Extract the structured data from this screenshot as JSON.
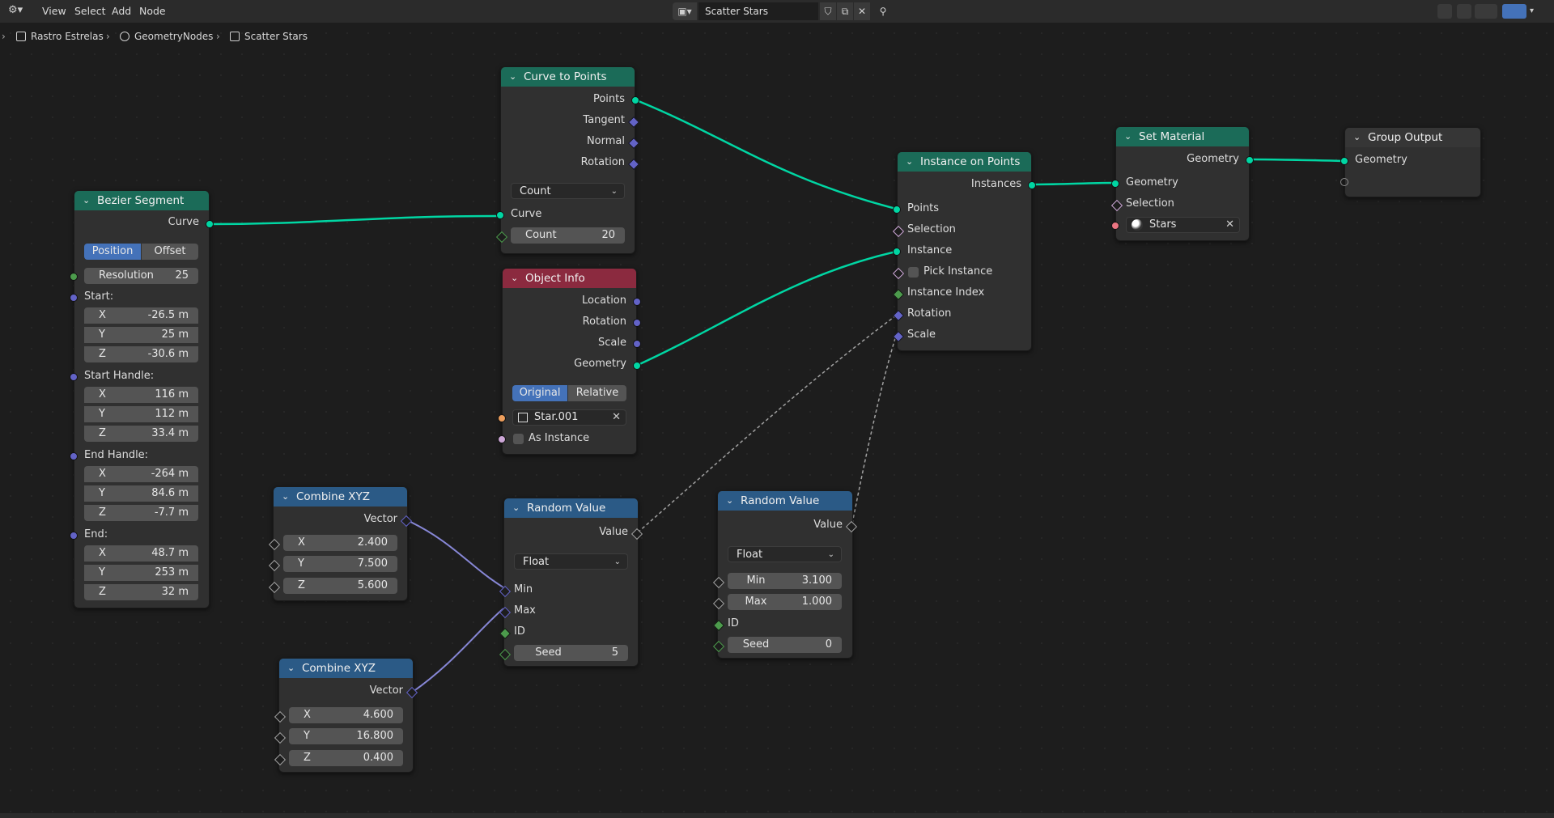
{
  "topbar": {
    "menus": [
      "View",
      "Select",
      "Add",
      "Node"
    ],
    "node_tree_name": "Scatter Stars"
  },
  "breadcrumb": {
    "object": "Rastro Estrelas",
    "modifier": "GeometryNodes",
    "tree": "Scatter Stars"
  },
  "nodes": {
    "bezier": {
      "title": "Bezier Segment",
      "out_curve": "Curve",
      "mode_position": "Position",
      "mode_offset": "Offset",
      "resolution_label": "Resolution",
      "resolution_value": "25",
      "start_label": "Start:",
      "start_x": "-26.5 m",
      "start_y": "25 m",
      "start_z": "-30.6 m",
      "start_handle_label": "Start Handle:",
      "sh_x": "116 m",
      "sh_y": "112 m",
      "sh_z": "33.4 m",
      "end_handle_label": "End Handle:",
      "eh_x": "-264 m",
      "eh_y": "84.6 m",
      "eh_z": "-7.7 m",
      "end_label": "End:",
      "end_x": "48.7 m",
      "end_y": "253 m",
      "end_z": "32 m",
      "axis_x": "X",
      "axis_y": "Y",
      "axis_z": "Z"
    },
    "curve_to_points": {
      "title": "Curve to Points",
      "out_points": "Points",
      "out_tangent": "Tangent",
      "out_normal": "Normal",
      "out_rotation": "Rotation",
      "mode": "Count",
      "in_curve": "Curve",
      "count_label": "Count",
      "count_value": "20"
    },
    "object_info": {
      "title": "Object Info",
      "out_location": "Location",
      "out_rotation": "Rotation",
      "out_scale": "Scale",
      "out_geometry": "Geometry",
      "mode_original": "Original",
      "mode_relative": "Relative",
      "object": "Star.001",
      "as_instance": "As Instance"
    },
    "instance_on_points": {
      "title": "Instance on Points",
      "out_instances": "Instances",
      "in_points": "Points",
      "in_selection": "Selection",
      "in_instance": "Instance",
      "in_pick_instance": "Pick Instance",
      "in_instance_index": "Instance Index",
      "in_rotation": "Rotation",
      "in_scale": "Scale"
    },
    "set_material": {
      "title": "Set Material",
      "out_geometry": "Geometry",
      "in_geometry": "Geometry",
      "in_selection": "Selection",
      "material": "Stars"
    },
    "group_output": {
      "title": "Group Output",
      "in_geometry": "Geometry"
    },
    "combine1": {
      "title": "Combine XYZ",
      "out_vector": "Vector",
      "x_label": "X",
      "x": "2.400",
      "y_label": "Y",
      "y": "7.500",
      "z_label": "Z",
      "z": "5.600"
    },
    "combine2": {
      "title": "Combine XYZ",
      "out_vector": "Vector",
      "x_label": "X",
      "x": "4.600",
      "y_label": "Y",
      "y": "16.800",
      "z_label": "Z",
      "z": "0.400"
    },
    "random1": {
      "title": "Random Value",
      "out_value": "Value",
      "type": "Float",
      "in_min": "Min",
      "in_max": "Max",
      "in_id": "ID",
      "seed_label": "Seed",
      "seed": "5"
    },
    "random2": {
      "title": "Random Value",
      "out_value": "Value",
      "type": "Float",
      "min_label": "Min",
      "min": "3.100",
      "max_label": "Max",
      "max": "1.000",
      "in_id": "ID",
      "seed_label": "Seed",
      "seed": "0"
    }
  },
  "colors": {
    "geometry_header": "#1b6b58",
    "input_header": "#8b2a3f",
    "converter_header": "#2b5a86",
    "geometry_socket": "#00d6a3",
    "vector_socket": "#6363c7",
    "float_socket": "#a1a1a1",
    "selected_toggle": "#4472b9"
  }
}
